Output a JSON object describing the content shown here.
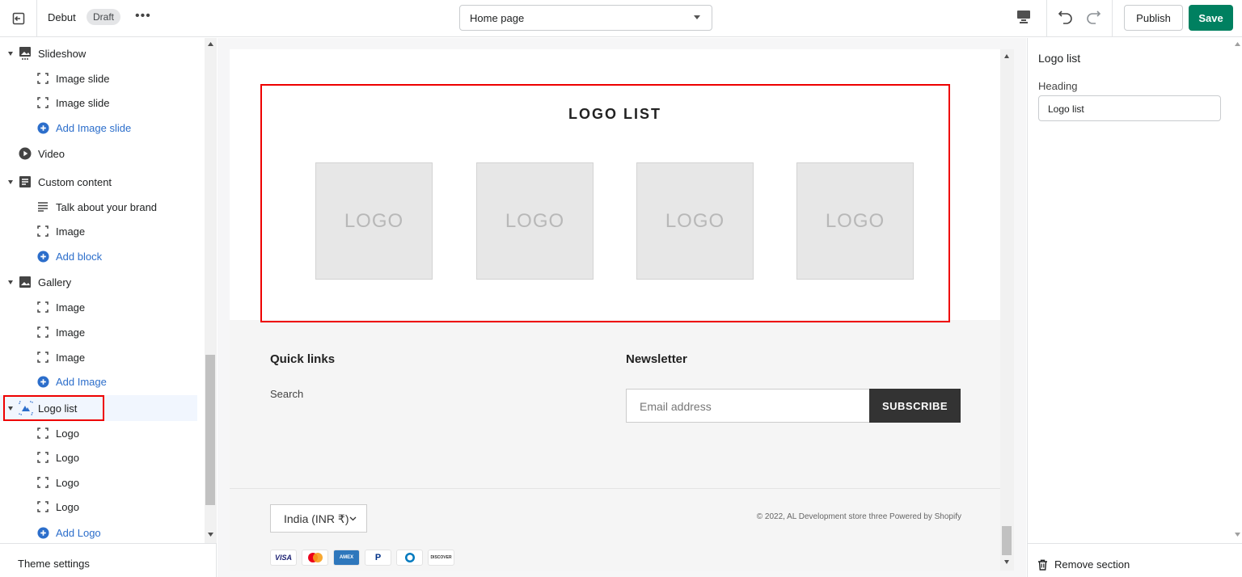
{
  "topbar": {
    "theme_name": "Debut",
    "draft_label": "Draft",
    "more_label": "•••",
    "page_select": "Home page",
    "publish_label": "Publish",
    "save_label": "Save"
  },
  "sidebar": {
    "slideshow": {
      "label": "Slideshow",
      "blocks": [
        "Image slide",
        "Image slide"
      ],
      "add": "Add Image slide"
    },
    "video": {
      "label": "Video"
    },
    "custom": {
      "label": "Custom content",
      "blocks": [
        "Talk about your brand",
        "Image"
      ],
      "add": "Add block"
    },
    "gallery": {
      "label": "Gallery",
      "blocks": [
        "Image",
        "Image",
        "Image"
      ],
      "add": "Add Image"
    },
    "logolist": {
      "label": "Logo list",
      "blocks": [
        "Logo",
        "Logo",
        "Logo",
        "Logo"
      ],
      "add": "Add Logo"
    },
    "theme_settings": "Theme settings"
  },
  "preview": {
    "logo_title": "LOGO LIST",
    "logo_placeholder": "LOGO",
    "quick_links": "Quick links",
    "search": "Search",
    "newsletter": "Newsletter",
    "email_placeholder": "Email address",
    "subscribe": "SUBSCRIBE",
    "currency": "India (INR ₹)",
    "copyright": "© 2022, AL Development store three Powered by Shopify",
    "payments": [
      "VISA",
      "Mastercard",
      "AMEX",
      "PayPal",
      "Diners",
      "DISCOVER"
    ]
  },
  "rpanel": {
    "title": "Logo list",
    "heading_label": "Heading",
    "heading_value": "Logo list",
    "remove": "Remove section"
  },
  "colors": {
    "accent_green": "#008060",
    "link_blue": "#2c6ecb",
    "highlight_red": "#e00000"
  }
}
